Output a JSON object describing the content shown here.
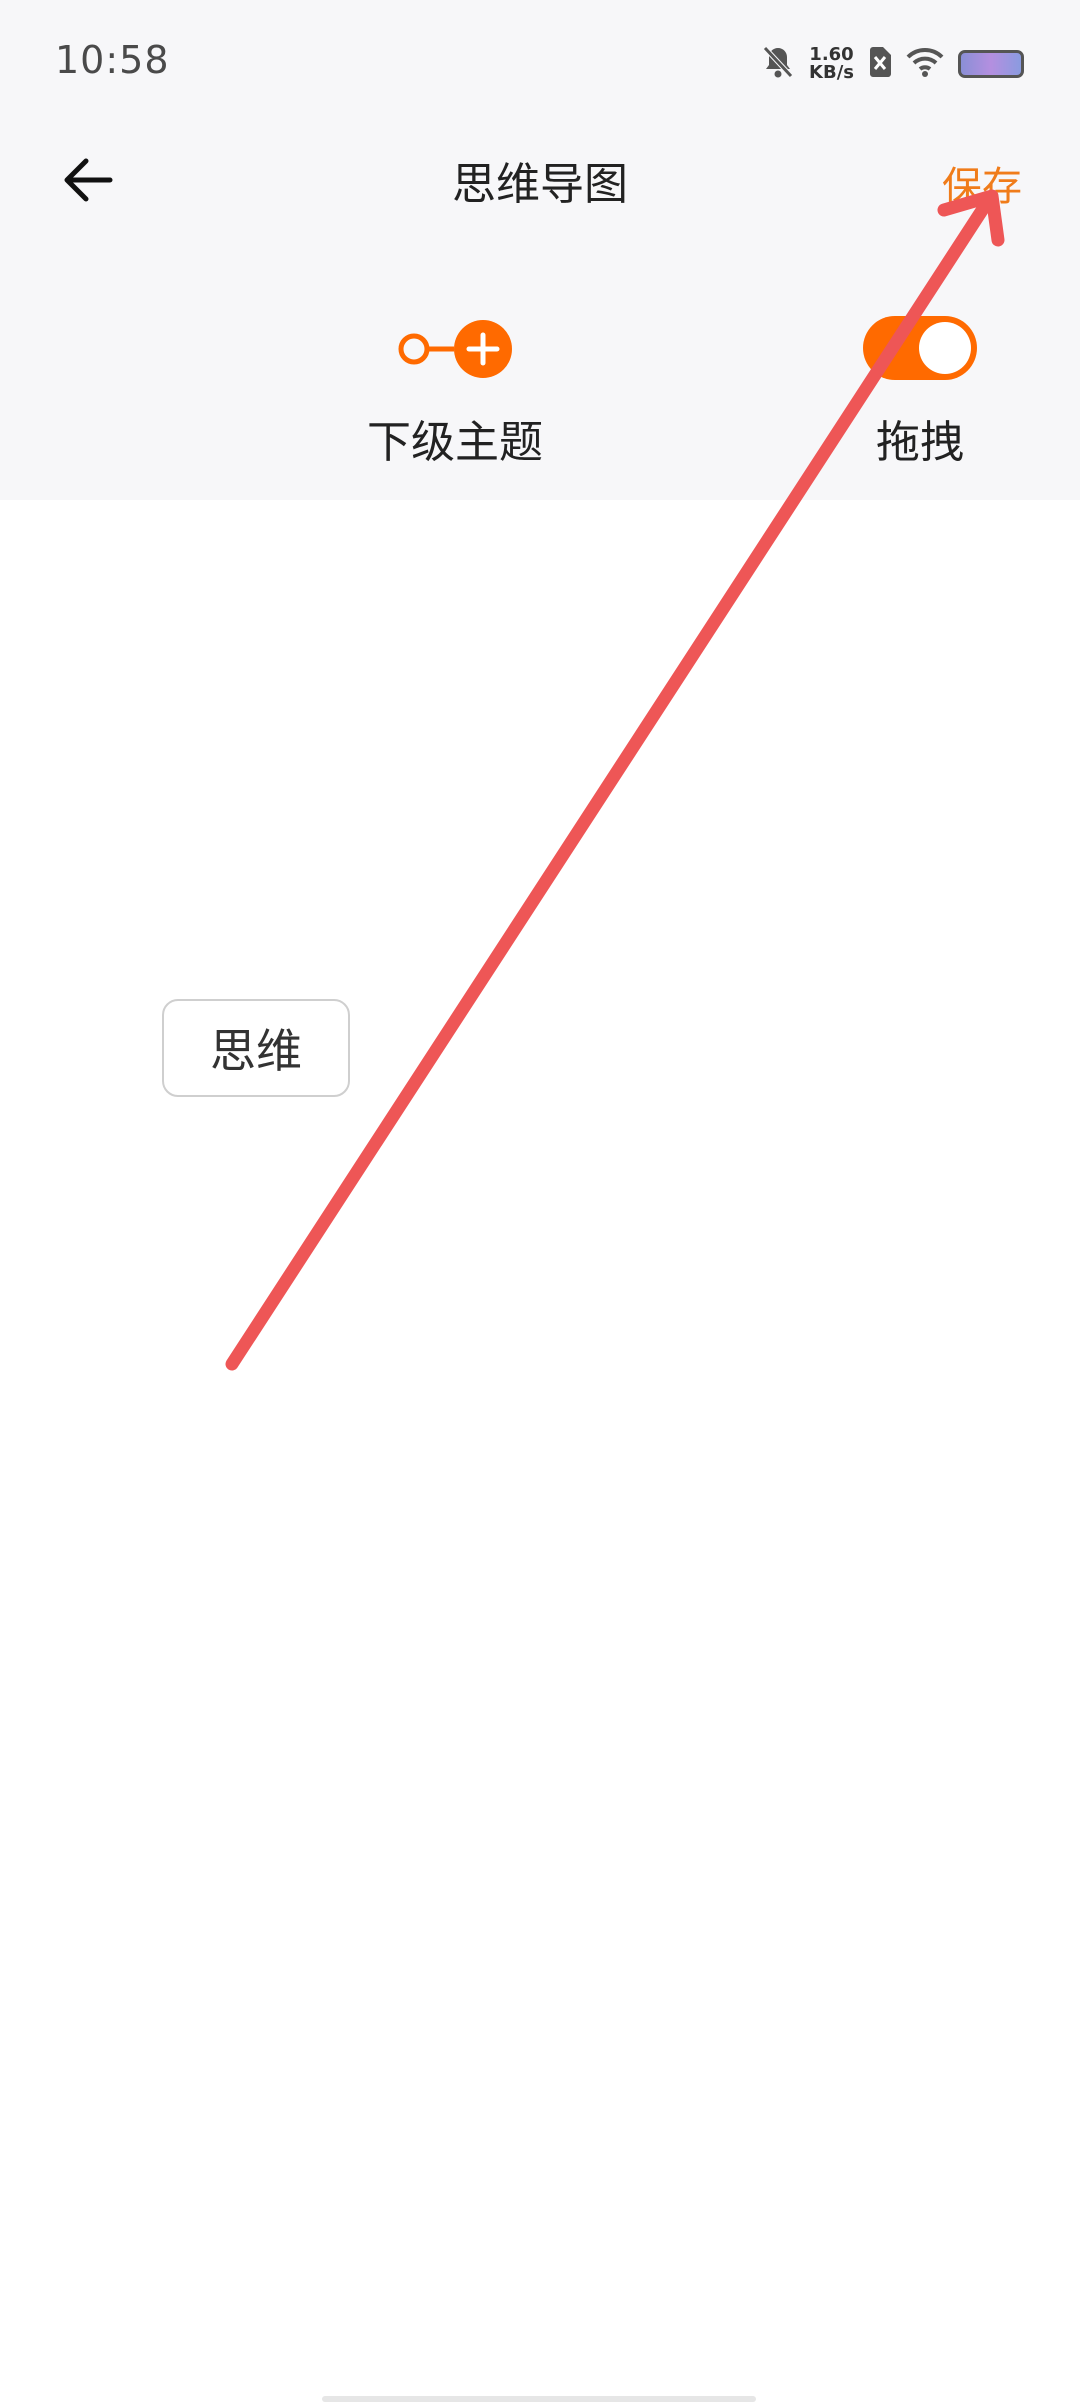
{
  "status_bar": {
    "time": "10:58",
    "net_speed_value": "1.60",
    "net_speed_unit": "KB/s",
    "icons": [
      "bell-muted-icon",
      "sim-x-icon",
      "wifi-icon",
      "battery-icon"
    ]
  },
  "header": {
    "title": "思维导图",
    "save_label": "保存",
    "back_icon": "arrow-left-icon"
  },
  "toolbar": {
    "subtopic_label": "下级主题",
    "drag_label": "拖拽",
    "drag_enabled": true
  },
  "canvas": {
    "root_node_text": "思维"
  },
  "colors": {
    "accent": "#ff6a00",
    "save_text": "#f07c1a",
    "annotation_arrow": "#ee5656"
  }
}
